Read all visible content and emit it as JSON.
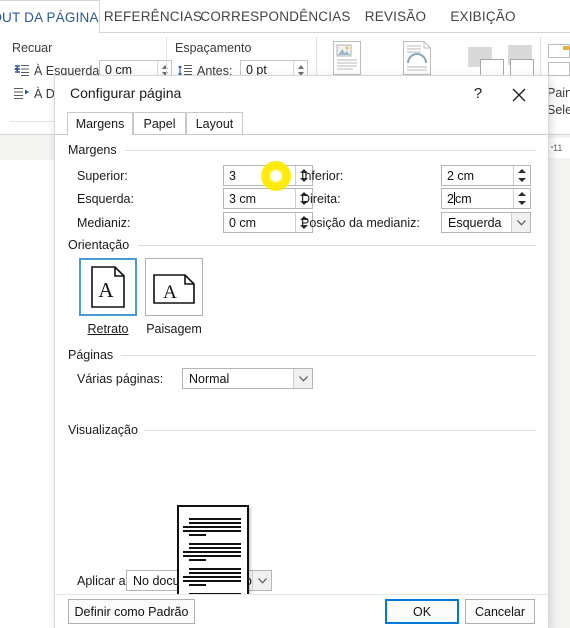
{
  "ribbon": {
    "tabs": [
      {
        "label": "OUT DA PÁGINA",
        "active": true
      },
      {
        "label": "REFERÊNCIAS",
        "active": false
      },
      {
        "label": "CORRESPONDÊNCIAS",
        "active": false
      },
      {
        "label": "REVISÃO",
        "active": false
      },
      {
        "label": "EXIBIÇÃO",
        "active": false
      }
    ],
    "groups": {
      "recuar_label": "Recuar",
      "espacamento_label": "Espaçamento"
    },
    "fields": {
      "esquerda_label": "À Esquerda:",
      "esquerda_value": "0 cm",
      "direita_label": "À D",
      "antes_label": "Antes:",
      "antes_value": "0 pt"
    },
    "right_panel": {
      "line1": "Pain",
      "line2": "Sele"
    },
    "ruler_mark": "11"
  },
  "dialog": {
    "title": "Configurar página",
    "help_icon": "?",
    "close_icon": "close-icon",
    "tabs": [
      {
        "label": "Margens",
        "active": true
      },
      {
        "label": "Papel",
        "active": false
      },
      {
        "label": "Layout",
        "active": false
      }
    ],
    "margins": {
      "group_label": "Margens",
      "superior_label": "Superior:",
      "superior_value": "3",
      "inferior_label": "Inferior:",
      "inferior_value": "2 cm",
      "esquerda_label": "Esquerda:",
      "esquerda_value": "3 cm",
      "direita_label": "Direita:",
      "direita_value_before_caret": "2",
      "direita_value_after_caret": " cm",
      "medianiz_label": "Medianiz:",
      "medianiz_value": "0 cm",
      "posicao_medianiz_label": "Posição da medianiz:",
      "posicao_medianiz_value": "Esquerda"
    },
    "orientation": {
      "group_label": "Orientação",
      "portrait_label": "Retrato",
      "landscape_label": "Paisagem",
      "selected": "Retrato"
    },
    "pages": {
      "group_label": "Páginas",
      "varias_paginas_label": "Várias páginas:",
      "varias_paginas_value": "Normal"
    },
    "preview": {
      "group_label": "Visualização",
      "aplicar_a_label": "Aplicar a:",
      "aplicar_a_value": "No documento inteiro"
    },
    "footer": {
      "default_button": "Definir como Padrão",
      "ok_button": "OK",
      "cancel_button": "Cancelar"
    }
  },
  "colors": {
    "accent_tab": "#2b579a",
    "focus_border": "#0078d7",
    "selection_border": "#4a9ad4",
    "click_highlight": "#ffeb00"
  }
}
